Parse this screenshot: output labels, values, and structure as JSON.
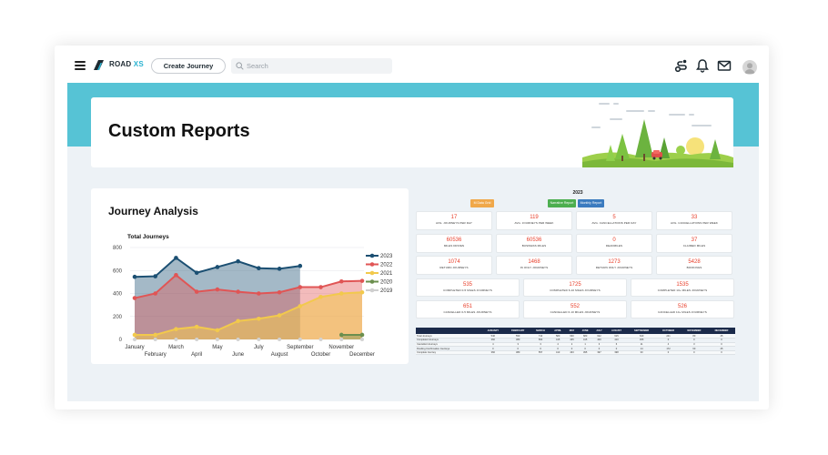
{
  "header": {
    "brand_main": "ROAD",
    "brand_accent": "XS",
    "create_label": "Create Journey",
    "search_placeholder": "Search"
  },
  "page": {
    "title": "Custom Reports"
  },
  "journey": {
    "title": "Journey Analysis",
    "chart_data": {
      "type": "area",
      "title": "Total Journeys",
      "categories": [
        "January",
        "February",
        "March",
        "April",
        "May",
        "June",
        "July",
        "August",
        "September",
        "October",
        "November",
        "December"
      ],
      "ylim": [
        0,
        800
      ],
      "yticks": [
        0,
        200,
        400,
        600,
        800
      ],
      "grid": true,
      "legend_position": "right",
      "series": [
        {
          "name": "2023",
          "color": "#1b4f72",
          "values": [
            545,
            550,
            710,
            580,
            630,
            680,
            620,
            615,
            640,
            null,
            null,
            null
          ]
        },
        {
          "name": "2022",
          "color": "#e05555",
          "values": [
            360,
            400,
            560,
            415,
            435,
            415,
            400,
            410,
            455,
            455,
            505,
            510
          ]
        },
        {
          "name": "2021",
          "color": "#f2c94c",
          "values": [
            40,
            40,
            90,
            110,
            80,
            160,
            180,
            210,
            290,
            370,
            400,
            410
          ]
        },
        {
          "name": "2020",
          "color": "#6b8f4e",
          "values": [
            null,
            null,
            null,
            null,
            null,
            null,
            null,
            null,
            null,
            null,
            40,
            40
          ]
        },
        {
          "name": "2019",
          "color": "#cfcfcf",
          "values": [
            null,
            null,
            null,
            null,
            null,
            null,
            null,
            null,
            null,
            null,
            null,
            null
          ]
        }
      ]
    }
  },
  "report": {
    "year": "2023",
    "buttons": [
      {
        "label": "M Data Grid",
        "color": "#f0a84a"
      },
      {
        "label": "Narrative Report",
        "color": "#4cae4f"
      },
      {
        "label": "Monthly Report",
        "color": "#3b7bbf"
      }
    ],
    "stats_row1": [
      {
        "value": "17",
        "label": "AVG. JOURNEYS PER DAY"
      },
      {
        "value": "119",
        "label": "AVG. JOURNEYS PER WEEK"
      },
      {
        "value": "5",
        "label": "AVG. CANCELLATIONS PER DAY"
      },
      {
        "value": "33",
        "label": "AVG. CANCELLATIONS PER WEEK"
      }
    ],
    "stats_row2": [
      {
        "value": "60536",
        "label": "MILES DRIVEN"
      },
      {
        "value": "60536",
        "label": "BUSINESS MILES"
      },
      {
        "value": "0",
        "label": "DEADMILES"
      },
      {
        "value": "37",
        "label": "CLAIMED MILES"
      }
    ],
    "stats_row3": [
      {
        "value": "1074",
        "label": "RETURN JOURNEYS"
      },
      {
        "value": "1468",
        "label": "IN ONLY JOURNEYS"
      },
      {
        "value": "1273",
        "label": "RETURN ONLY JOURNEYS"
      },
      {
        "value": "5428",
        "label": "BOOKINGS"
      }
    ],
    "stats_row4": [
      {
        "value": "535",
        "label": "COMPLETED 0-5 MILES JOURNEYS"
      },
      {
        "value": "1725",
        "label": "COMPLETED 6-10 MILES JOURNEYS"
      },
      {
        "value": "1535",
        "label": "COMPLETED 10+ MILES JOURNEYS"
      }
    ],
    "stats_row5": [
      {
        "value": "651",
        "label": "CANCELLED 0-5 MILES JOURNEYS"
      },
      {
        "value": "552",
        "label": "CANCELLED 6-10 MILES JOURNEYS"
      },
      {
        "value": "526",
        "label": "CANCELLED 10+ MILES JOURNEYS"
      }
    ],
    "table": {
      "headers": [
        "",
        "JANUARY",
        "FEBRUARY",
        "MARCH",
        "APRIL",
        "MAY",
        "JUNE",
        "JULY",
        "AUGUST",
        "SEPTEMBER",
        "OCTOBER",
        "NOVEMBER",
        "DECEMBER"
      ],
      "rows": [
        [
          "Total Journeys",
          "546",
          "550",
          "710",
          "580",
          "630",
          "680",
          "622",
          "615",
          "640",
          "241",
          "80",
          "45"
        ],
        [
          "Completed Journeys",
          "360",
          "380",
          "560",
          "415",
          "435",
          "415",
          "400",
          "410",
          "455",
          "0",
          "0",
          "0"
        ],
        [
          "Cancelled Journeys",
          "4",
          "3",
          "3",
          "4",
          "2",
          "1",
          "3",
          "6",
          "11",
          "4",
          "3",
          "0"
        ],
        [
          "Pending Confirmation Journeys",
          "0",
          "0",
          "0",
          "0",
          "0",
          "0",
          "0",
          "0",
          "14",
          "172",
          "60",
          "45"
        ],
        [
          "Complete Journey",
          "360",
          "380",
          "557",
          "413",
          "433",
          "395",
          "397",
          "398",
          "30",
          "0",
          "0",
          "0"
        ]
      ]
    }
  }
}
